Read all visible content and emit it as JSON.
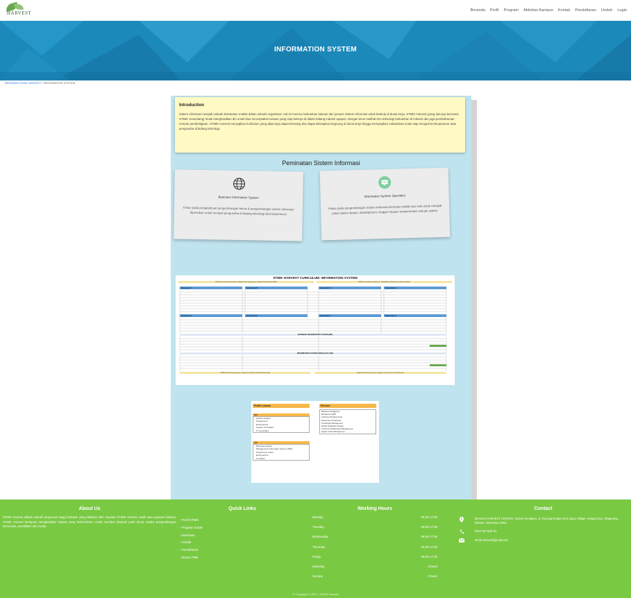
{
  "header": {
    "logo_text": "HARVEST",
    "nav": [
      "Beranda",
      "Profil",
      "Program",
      "Aktivitas Kampus",
      "Kontak",
      "Pendaftaran",
      "Unduh",
      "Login"
    ]
  },
  "banner": {
    "title": "INFORMATION SYSTEM"
  },
  "breadcrumb": {
    "home": "BERANDA STMIK HARVEST",
    "separator": " / ",
    "current": "INFORMATION SYSTEM"
  },
  "intro": {
    "title": "Introduction",
    "text": "Sistem Informasi menjadi sebuah kebutuhan mutlak dalam sebuah organisasi. Hal ini memicu kebutuhan lulusan dari jurusan Sistem Informasi untuk bekerja di dunia kerja. STMIK Harvest (yang dulunya bernama STMIK Sumedang) mulai menghasilkan diri untuk bisa menciptakan lulusan yang siap bekerja di dalam bidang industri apapun, dengan terus melihat tren teknologi kebutuhan di industri dan juga pembaharuan metode pembelajaran. STMIK Harvest menyajikan kurikulum yang dipercaya dapat bersaing dan dapat diterapkan langsung di dunia kerja hingga menyiapkan mahasiswa untuk siap menjadi technopreneur atau pengusaha di bidang teknologi."
  },
  "peminatan": {
    "title": "Peminatan Sistem Informasi",
    "cards": [
      {
        "title": "Business Information System",
        "desc": "Fokus pada pengetahuan pengembangan bisnis & pengembangan sistem informasi diperlukan untuk menjadi pengusaha di bidang teknologi (technopreneur)",
        "icon": "globe-icon"
      },
      {
        "title": "Information System Specialist",
        "desc": "Fokus pada pengembangan Sistem Informasi berbasis mobile dan web untuk menjadi pakar dalam desain, development, hingga maupun implementasi sebuah sistem.",
        "icon": "chat-icon"
      }
    ]
  },
  "curriculum": {
    "title": "STMIK HARVEST CURICULUM: INFORMATION SYSTEM",
    "band_left": "STMIK E-Learning Outcome: Mastering Programming, Data & Engineering Skills",
    "band_right": "STMIK E-Learning Outcome: Scalability & Business Implementation",
    "semesters": [
      "Semester 1",
      "Semester 2",
      "Semester 3",
      "Semester 4",
      "Semester 5",
      "Semester 6",
      "Semester 7",
      "Semester 8"
    ],
    "mid_band_1": "BUSINESS INFORMATION SYSTEM (BIS)",
    "mid_band_2": "INFORMATION SYSTEM SPECIALIST (ISS)",
    "band_bottom_left": "STMIK E-Learning Outcome: Ready for Industry & Entrepreneurship",
    "band_bottom_right": "Final E-Learning Outcome: Ready to work & be a technopreneur"
  },
  "elective": {
    "profile_title": "Profil Lulusan",
    "bis_label": "BIS",
    "bis_items": [
      "System Analyst",
      "Programmer",
      "Entrepreneur",
      "System Consultant",
      "IT Consultant"
    ],
    "iss_label": "ISS",
    "iss_items": [
      "Business Analyst",
      "Management Information System (MIS)",
      "Programmer (web)",
      "Entrepreneur",
      "IT Auditor"
    ],
    "elective_title": "Elective",
    "elective_items": [
      "Business Intelligence",
      "Manajemen ERP",
      "Advanced Programming",
      "Enterprise Architecture",
      "Knowledge Management",
      "Mobile Application Design",
      "Customer Relationship Management",
      "Supply Chain Management"
    ]
  },
  "footer": {
    "about_title": "About Us",
    "about_text": "STMIK Harvest adalah sebuah perguruan tinggi berbasis yang didirikan oleh Yayasan STMIK Harvest, salah satu yayasan kristiani. STMIK Harvest bertujuan menghasilkan lulusan yang berkomitmen untuk memberi dampak pada dunia melalui pengembangan komunitas, pendidikan dan media.",
    "links_title": "Quick Links",
    "links": [
      "Profil STMIK",
      "Program Kuliah",
      "Beasiswa",
      "Kontak",
      "Pendaftaran",
      "Brosur PMB"
    ],
    "hours_title": "Working Hours",
    "hours": [
      {
        "day": "Monday",
        "time": "09.00-17.00"
      },
      {
        "day": "Tuesday",
        "time": "09.00-17.00"
      },
      {
        "day": "Wednesday",
        "time": "09.00-17.00"
      },
      {
        "day": "Thursday",
        "time": "09.00-17.00"
      },
      {
        "day": "Friday",
        "time": "09.00-17.00"
      },
      {
        "day": "Saturday",
        "time": "Closed"
      },
      {
        "day": "Sunday",
        "time": "Closed"
      }
    ],
    "contact_title": "Contact",
    "address": "MAXIUS HARVEST CENTER, Taman Himalaya, Jl. Gunung Empat No.9 Lippo Village, Kelapa Dua, Tangerang Banten, Indonesia 15811",
    "phone": "0812 95 6344 81",
    "email": "stmik.harvest@gmail.com",
    "copyright": "© Copyright © 2021 - STMIK Harvest"
  }
}
